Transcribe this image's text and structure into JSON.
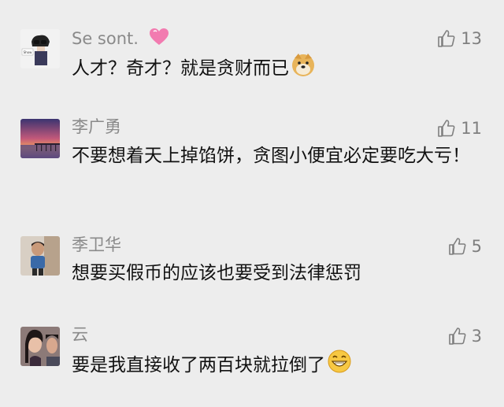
{
  "comments": [
    {
      "nickname": "Se sont.",
      "nickname_icon": "pink-heart-icon",
      "likes": "13",
      "text": "人才？奇才？就是贪财而已",
      "text_icon": "doge-emoji-icon",
      "avatar": "cartoon-avatar"
    },
    {
      "nickname": "李广勇",
      "likes": "11",
      "text": "不要想着天上掉馅饼，贪图小便宜必定要吃大亏！",
      "avatar": "sunset-pier-avatar"
    },
    {
      "nickname": "季卫华",
      "likes": "5",
      "text": "想要买假币的应该也要受到法律惩罚",
      "avatar": "child-photo-avatar"
    },
    {
      "nickname": "云",
      "likes": "3",
      "text": "要是我直接收了两百块就拉倒了",
      "text_icon": "grin-emoji-icon",
      "avatar": "couple-photo-avatar"
    }
  ],
  "colors": {
    "background": "#ededed",
    "nickname": "#8a8a8a",
    "text": "#111111",
    "like": "#7f7f7f"
  }
}
